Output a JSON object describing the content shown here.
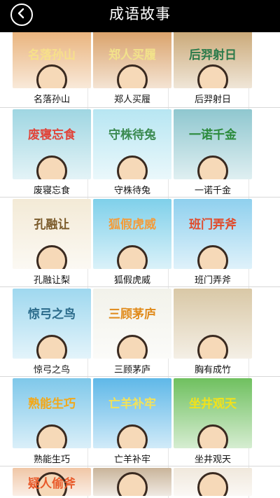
{
  "header": {
    "title": "成语故事",
    "back_icon": "chevron-left-icon"
  },
  "stories": [
    {
      "caption": "名落孙山",
      "thumb_text": "名落孙山",
      "bg": "#e9b27a",
      "text_color": "#f7e08a"
    },
    {
      "caption": "郑人买履",
      "thumb_text": "郑人买履",
      "bg": "#d9a067",
      "text_color": "#f2e28a"
    },
    {
      "caption": "后羿射日",
      "thumb_text": "后羿射日",
      "bg": "#c9a775",
      "text_color": "#2a7a4a"
    },
    {
      "caption": "废寝忘食",
      "thumb_text": "废寝忘食",
      "bg": "#9fd6e2",
      "text_color": "#e0443a"
    },
    {
      "caption": "守株待兔",
      "thumb_text": "守株待兔",
      "bg": "#b7e6f2",
      "text_color": "#3b8a50"
    },
    {
      "caption": "一诺千金",
      "thumb_text": "一诺千金",
      "bg": "#8fc7cf",
      "text_color": "#2b8a3c"
    },
    {
      "caption": "孔融让梨",
      "thumb_text": "孔融让",
      "bg": "#f3ead6",
      "text_color": "#7a5a2a"
    },
    {
      "caption": "狐假虎威",
      "thumb_text": "狐假虎威",
      "bg": "#7fd0ea",
      "text_color": "#f39c3b"
    },
    {
      "caption": "班门弄斧",
      "thumb_text": "班门弄斧",
      "bg": "#8fd0ee",
      "text_color": "#e14a2a"
    },
    {
      "caption": "惊弓之鸟",
      "thumb_text": "惊弓之鸟",
      "bg": "#9fd8ef",
      "text_color": "#2a6a8a"
    },
    {
      "caption": "三顾茅庐",
      "thumb_text": "三顾茅庐",
      "bg": "#f2f2ea",
      "text_color": "#e08a1a"
    },
    {
      "caption": "胸有成竹",
      "thumb_text": "",
      "bg": "#d9c8a6",
      "text_color": "#3a3a3a"
    },
    {
      "caption": "熟能生巧",
      "thumb_text": "熟能生巧",
      "bg": "#7fc8ea",
      "text_color": "#f2a81a"
    },
    {
      "caption": "亡羊补牢",
      "thumb_text": "亡羊补牢",
      "bg": "#5fb8e8",
      "text_color": "#f2e25a"
    },
    {
      "caption": "坐井观天",
      "thumb_text": "坐井观天",
      "bg": "#6fc05f",
      "text_color": "#f2e21a"
    },
    {
      "caption": "",
      "thumb_text": "疑人偷斧",
      "bg": "#f0c6a6",
      "text_color": "#e85a2a"
    },
    {
      "caption": "",
      "thumb_text": "",
      "bg": "#c9b49a",
      "text_color": "#3a3a3a"
    },
    {
      "caption": "",
      "thumb_text": "",
      "bg": "#f0e8dc",
      "text_color": "#3a3a3a"
    }
  ]
}
